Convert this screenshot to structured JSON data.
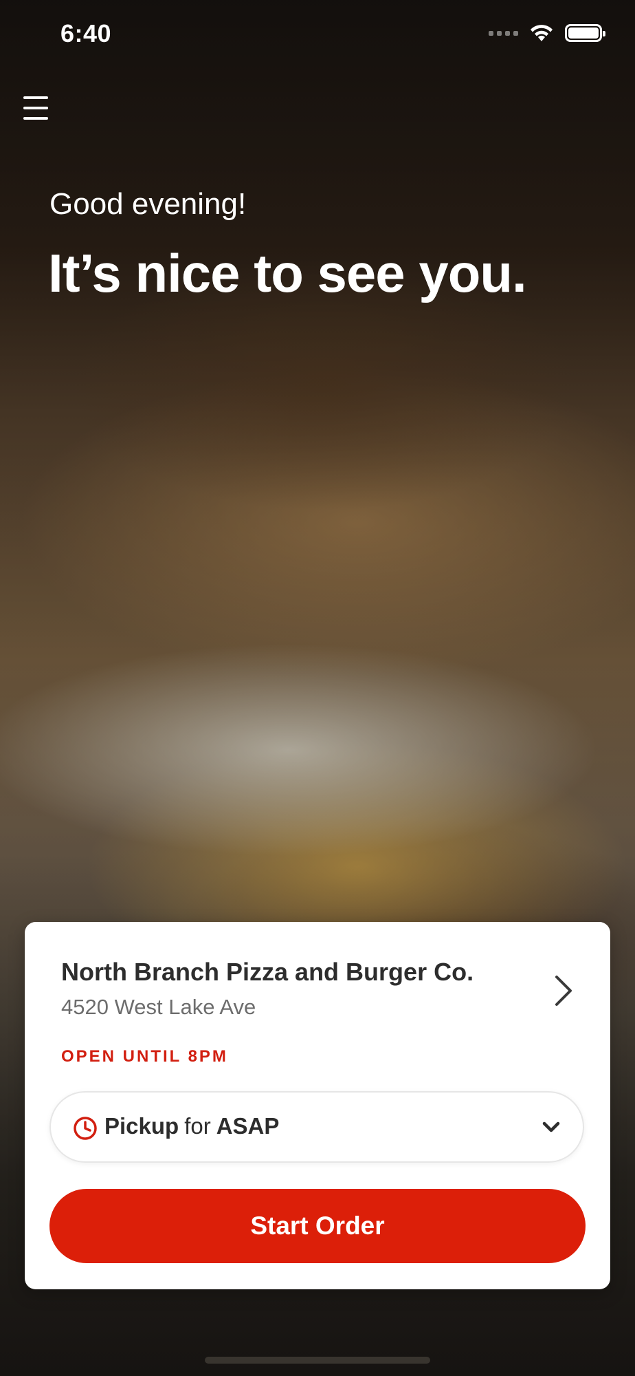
{
  "status_bar": {
    "time": "6:40"
  },
  "hero": {
    "greeting": "Good evening!",
    "headline": "It’s nice to see you."
  },
  "store": {
    "name": "North Branch Pizza and Burger Co.",
    "address": "4520 West Lake Ave",
    "status": "OPEN UNTIL 8PM"
  },
  "order": {
    "mode": "Pickup",
    "connector": "for",
    "time": "ASAP",
    "start_label": "Start Order"
  },
  "icons": {
    "menu": "hamburger-menu-icon",
    "clock": "clock-icon",
    "chevron_right": "chevron-right-icon",
    "chevron_down": "chevron-down-icon",
    "wifi": "wifi-icon",
    "battery": "battery-icon",
    "signal": "signal-icon"
  },
  "colors": {
    "accent": "#dc1f09",
    "status_text": "#d21f10",
    "card_bg": "#ffffff",
    "text_primary": "#2d2d2d",
    "text_secondary": "#6d6d6d"
  }
}
